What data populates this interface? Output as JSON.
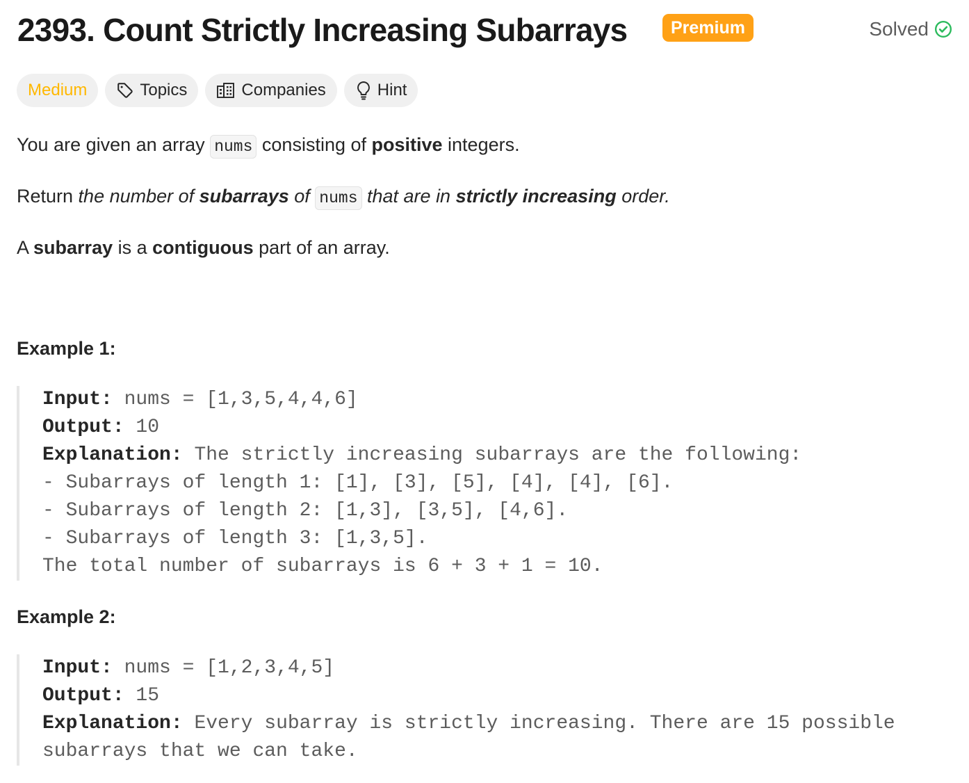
{
  "problem": {
    "title": "2393. Count Strictly Increasing Subarrays",
    "premium_label": "Premium",
    "status_label": "Solved",
    "colors": {
      "premium": "#ffa116",
      "medium": "#ffb800",
      "solved": "#2cbb5d"
    }
  },
  "tags": [
    {
      "label": "Medium",
      "icon": null
    },
    {
      "label": "Topics",
      "icon": "tag-icon"
    },
    {
      "label": "Companies",
      "icon": "building-icon"
    },
    {
      "label": "Hint",
      "icon": "lightbulb-icon"
    }
  ],
  "description": {
    "p1": {
      "a": "You are given an array ",
      "code": "nums",
      "b": " consisting of ",
      "strong": "positive",
      "c": " integers."
    },
    "p2": {
      "a": "Return ",
      "i1": "the number of ",
      "strong1": "subarrays",
      "i2": " of ",
      "code": "nums",
      "i3": " that are in ",
      "strong2": "strictly increasing",
      "i4": " order."
    },
    "p3": {
      "a": "A ",
      "strong1": "subarray",
      "b": " is a ",
      "strong2": "contiguous",
      "c": " part of an array."
    }
  },
  "examples": [
    {
      "title": "Example 1:",
      "input_label": "Input:",
      "input": " nums = [1,3,5,4,4,6]",
      "output_label": "Output:",
      "output": " 10",
      "explanation_label": "Explanation:",
      "explanation_lines": [
        " The strictly increasing subarrays are the following:",
        "- Subarrays of length 1: [1], [3], [5], [4], [4], [6].",
        "- Subarrays of length 2: [1,3], [3,5], [4,6].",
        "- Subarrays of length 3: [1,3,5].",
        "The total number of subarrays is 6 + 3 + 1 = 10."
      ]
    },
    {
      "title": "Example 2:",
      "input_label": "Input:",
      "input": " nums = [1,2,3,4,5]",
      "output_label": "Output:",
      "output": " 15",
      "explanation_label": "Explanation:",
      "explanation_lines": [
        " Every subarray is strictly increasing. There are 15 possible",
        "subarrays that we can take."
      ]
    }
  ]
}
